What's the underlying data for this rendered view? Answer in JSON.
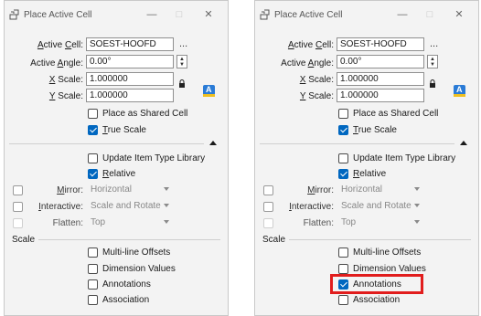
{
  "dialogs": [
    {
      "title": "Place Active Cell",
      "active_cell_label": "Active Cell:",
      "active_cell_value": "SOEST-HOOFD",
      "browse_label": "...",
      "active_angle_label": "Active Angle:",
      "active_angle_value": "0.00°",
      "x_scale_label": "X Scale:",
      "x_scale_value": "1.000000",
      "y_scale_label": "Y Scale:",
      "y_scale_value": "1.000000",
      "place_shared_label": "Place as Shared Cell",
      "true_scale_label": "True Scale",
      "update_item_label": "Update Item Type Library",
      "relative_label": "Relative",
      "mirror_label": "Mirror:",
      "mirror_value": "Horizontal",
      "interactive_label": "Interactive:",
      "interactive_value": "Scale and Rotate",
      "flatten_label": "Flatten:",
      "flatten_value": "Top",
      "scale_section": "Scale",
      "multiline_label": "Multi-line Offsets",
      "dimension_label": "Dimension Values",
      "annotations_label": "Annotations",
      "association_label": "Association",
      "states": {
        "place_shared": false,
        "true_scale": true,
        "update_item": false,
        "relative": true,
        "mirror": false,
        "interactive": false,
        "flatten": false,
        "multiline": false,
        "dimension": false,
        "annotations": false,
        "association": false
      }
    },
    {
      "title": "Place Active Cell",
      "active_cell_label": "Active Cell:",
      "active_cell_value": "SOEST-HOOFD",
      "browse_label": "...",
      "active_angle_label": "Active Angle:",
      "active_angle_value": "0.00°",
      "x_scale_label": "X Scale:",
      "x_scale_value": "1.000000",
      "y_scale_label": "Y Scale:",
      "y_scale_value": "1.000000",
      "place_shared_label": "Place as Shared Cell",
      "true_scale_label": "True Scale",
      "update_item_label": "Update Item Type Library",
      "relative_label": "Relative",
      "mirror_label": "Mirror:",
      "mirror_value": "Horizontal",
      "interactive_label": "Interactive:",
      "interactive_value": "Scale and Rotate",
      "flatten_label": "Flatten:",
      "flatten_value": "Top",
      "scale_section": "Scale",
      "multiline_label": "Multi-line Offsets",
      "dimension_label": "Dimension Values",
      "annotations_label": "Annotations",
      "association_label": "Association",
      "states": {
        "place_shared": false,
        "true_scale": true,
        "update_item": false,
        "relative": true,
        "mirror": false,
        "interactive": false,
        "flatten": false,
        "multiline": false,
        "dimension": false,
        "annotations": true,
        "association": false
      }
    }
  ],
  "icons": {
    "app": "place-cell-icon",
    "minimize": "minimize-icon",
    "maximize": "maximize-icon",
    "close": "close-icon",
    "lock": "lock-icon",
    "annotation_scale": "annotation-scale-icon",
    "collapse": "collapse-up-icon",
    "dropdown": "chevron-down-icon"
  },
  "colors": {
    "checkbox_checked": "#0067c0",
    "highlight": "#e11d1d"
  }
}
